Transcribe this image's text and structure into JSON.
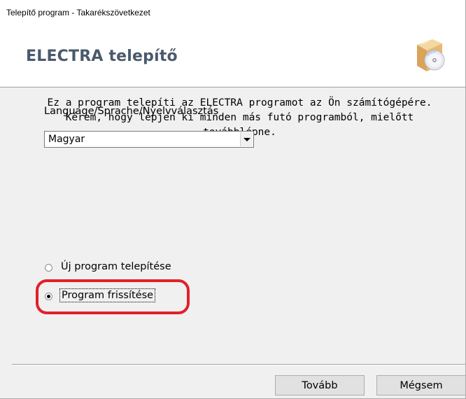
{
  "window": {
    "title": "Telepítő program - Takarékszövetkezet"
  },
  "header": {
    "heading": "ELECTRA telepítő",
    "icon": "software-box-cd-icon"
  },
  "intro_text": "Ez a program telepíti az ELECTRA  programot az Ön számítógépére.\nKérem, hogy lépjen ki minden más futó  programból, mielőtt\ntovábblépne.",
  "language": {
    "label": "Language/Sprache/Nyelvválasztás",
    "selected": "Magyar"
  },
  "options": [
    {
      "label": "Új program telepítése",
      "checked": false
    },
    {
      "label": "Program frissítése",
      "checked": true
    }
  ],
  "annotation": {
    "color": "#e2202a"
  },
  "buttons": {
    "next": "Tovább",
    "cancel": "Mégsem"
  }
}
